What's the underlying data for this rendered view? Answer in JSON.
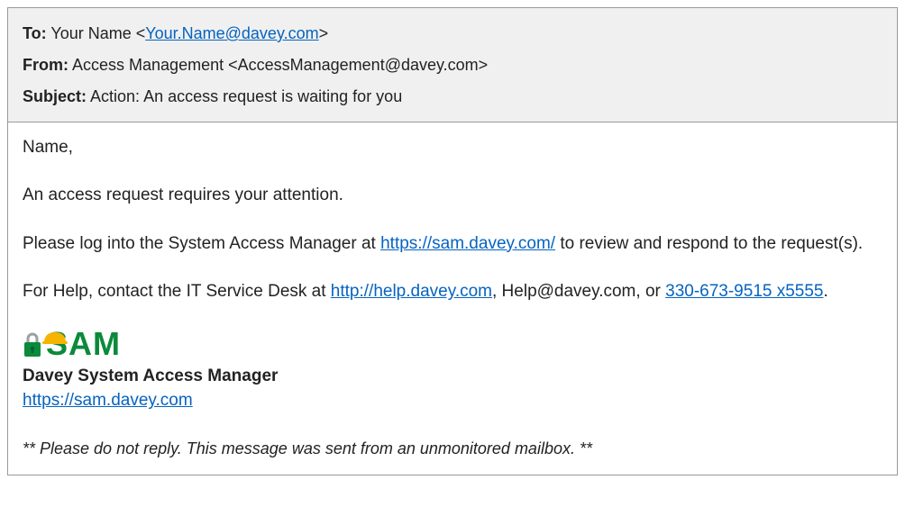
{
  "header": {
    "to_label": "To:",
    "to_name": "Your Name ",
    "to_open": "<",
    "to_email": "Your.Name@davey.com",
    "to_close": ">",
    "from_label": "From:",
    "from_value": "Access Management <AccessManagement@davey.com>",
    "subject_label": "Subject:",
    "subject_value": "Action: An access request is waiting for you"
  },
  "body": {
    "greeting": "Name,",
    "line1": "An access request requires your attention.",
    "line2_pre": "Please log into the System Access Manager at ",
    "line2_link": "https://sam.davey.com/",
    "line2_post": " to review and respond to the request(s).",
    "line3_pre": "For Help, contact the IT Service Desk at ",
    "line3_link1": "http://help.davey.com",
    "line3_mid": ", Help@davey.com, or ",
    "line3_link2": "330-673-9515 x5555",
    "line3_end": "."
  },
  "signature": {
    "sam_text": "SAM",
    "title": "Davey System Access Manager",
    "link": "https://sam.davey.com"
  },
  "footnote": "** Please do not reply.  This message was sent from an unmonitored mailbox. **"
}
